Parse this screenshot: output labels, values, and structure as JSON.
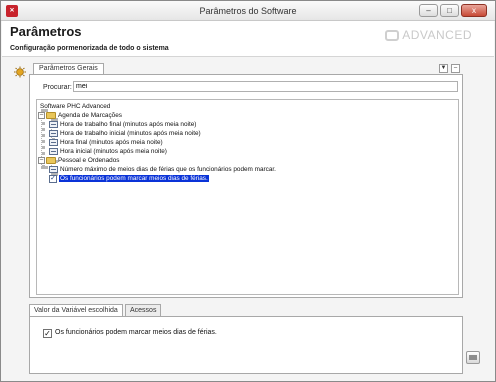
{
  "window": {
    "title": "Parâmetros do Software",
    "app_icon": "phc-app-icon",
    "controls": {
      "minimize": "–",
      "maximize": "□",
      "close": "x"
    }
  },
  "header": {
    "title": "Parâmetros",
    "subtitle": "Configuração pormenorizada de todo o sistema",
    "brand": "ADVANCED"
  },
  "main_tab": {
    "label": "Parâmetros Gerais"
  },
  "corner_controls": {
    "expand": "▼",
    "collapse": "–"
  },
  "search": {
    "label": "Procurar:",
    "value": "mei"
  },
  "tree": {
    "root": "Software PHC Advanced",
    "groups": [
      {
        "label": "Agenda de Marcações",
        "expander": "–",
        "items": [
          "Hora de trabalho final (minutos após meia noite)",
          "Hora de trabalho inicial (minutos após meia noite)",
          "Hora final (minutos após meia noite)",
          "Hora inicial (minutos após meia noite)"
        ]
      },
      {
        "label": "Pessoal e Ordenados",
        "expander": "–",
        "items": [
          "Número máximo de meios dias de férias que os funcionários podem marcar.",
          "Os funcionários podem marcar meios dias de férias."
        ]
      }
    ],
    "selected_item": "Os funcionários podem marcar meios dias de férias."
  },
  "bottom_tabs": {
    "active": "Valor da Variável escolhida",
    "inactive": "Acessos"
  },
  "option": {
    "checked": true,
    "check_mark": "✓",
    "label": "Os funcionários podem marcar meios dias de férias."
  },
  "colors": {
    "selection": "#0a33d8",
    "close_button": "#c74a36",
    "folder": "#e9c65a"
  }
}
